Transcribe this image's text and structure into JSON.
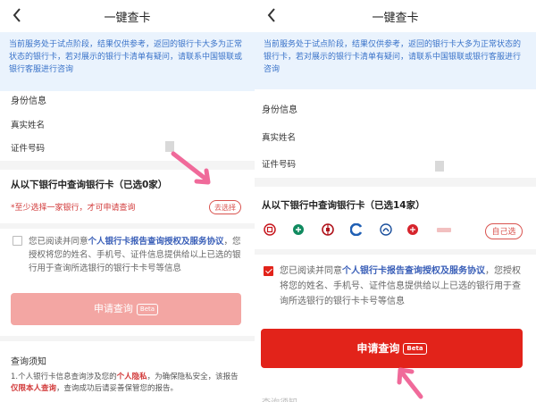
{
  "left": {
    "title": "一键查卡",
    "notice": "当前服务处于试点阶段，结果仅供参考，返回的银行卡大多为正常状态的银行卡，若对展示的银行卡清单有疑问，请联系中国银联或银行客服进行咨询",
    "section_identity": "身份信息",
    "field_name": "真实姓名",
    "field_id": "证件号码",
    "bank_title": "从以下银行中查询银行卡（已选0家）",
    "warning": "*至少选择一家银行，才可申请查询",
    "select_button": "去选择",
    "consent_prefix": "您已阅读并同意",
    "consent_link": "个人银行卡报告查询授权及服务协议",
    "consent_rest": "，您授权将您的姓名、手机号、证件信息提供给以上已选的银行用于查询所选银行的银行卡卡号等信息",
    "apply_label": "申请查询",
    "beta": "Beta",
    "notes_title": "查询须知",
    "notes_text_1": "1.个人银行卡信息查询涉及您的",
    "notes_privacy": "个人隐私",
    "notes_text_2": "，为确保隐私安全，该报告",
    "notes_self_only": "仅限本人查询",
    "notes_text_3": "，查询成功后请妥善保管您的报告。"
  },
  "right": {
    "title": "一键查卡",
    "notice": "当前服务处于试点阶段，结果仅供参考，返回的银行卡大多为正常状态的银行卡，若对展示的银行卡清单有疑问，请联系中国银联或银行客服进行咨询",
    "section_identity": "身份信息",
    "field_name": "真实姓名",
    "field_id": "证件号码",
    "bank_title": "从以下银行中查询银行卡（已选14家）",
    "select_button": "自己选",
    "consent_prefix": "您已阅读并同意",
    "consent_link": "个人银行卡报告查询授权及服务协议",
    "consent_rest": "，您授权将您的姓名、手机号、证件信息提供给以上已选的银行用于查询所选银行的银行卡卡号等信息",
    "apply_label": "申请查询",
    "beta": "Beta",
    "notes_title_partial": "查询须知"
  },
  "colors": {
    "accent_red": "#e2231a",
    "disabled_red": "#f3a6a3",
    "notice_bg": "#eaf3fd",
    "notice_text": "#3a73c9",
    "arrow_pink": "#f06a9a"
  },
  "icons": {
    "back": "chevron-left-icon",
    "banks": [
      "icbc-logo-icon",
      "abc-logo-icon",
      "boc-logo-icon",
      "ccb-logo-icon",
      "bocom-logo-icon",
      "cmb-logo-icon",
      "bank-small-logo-icon"
    ]
  }
}
